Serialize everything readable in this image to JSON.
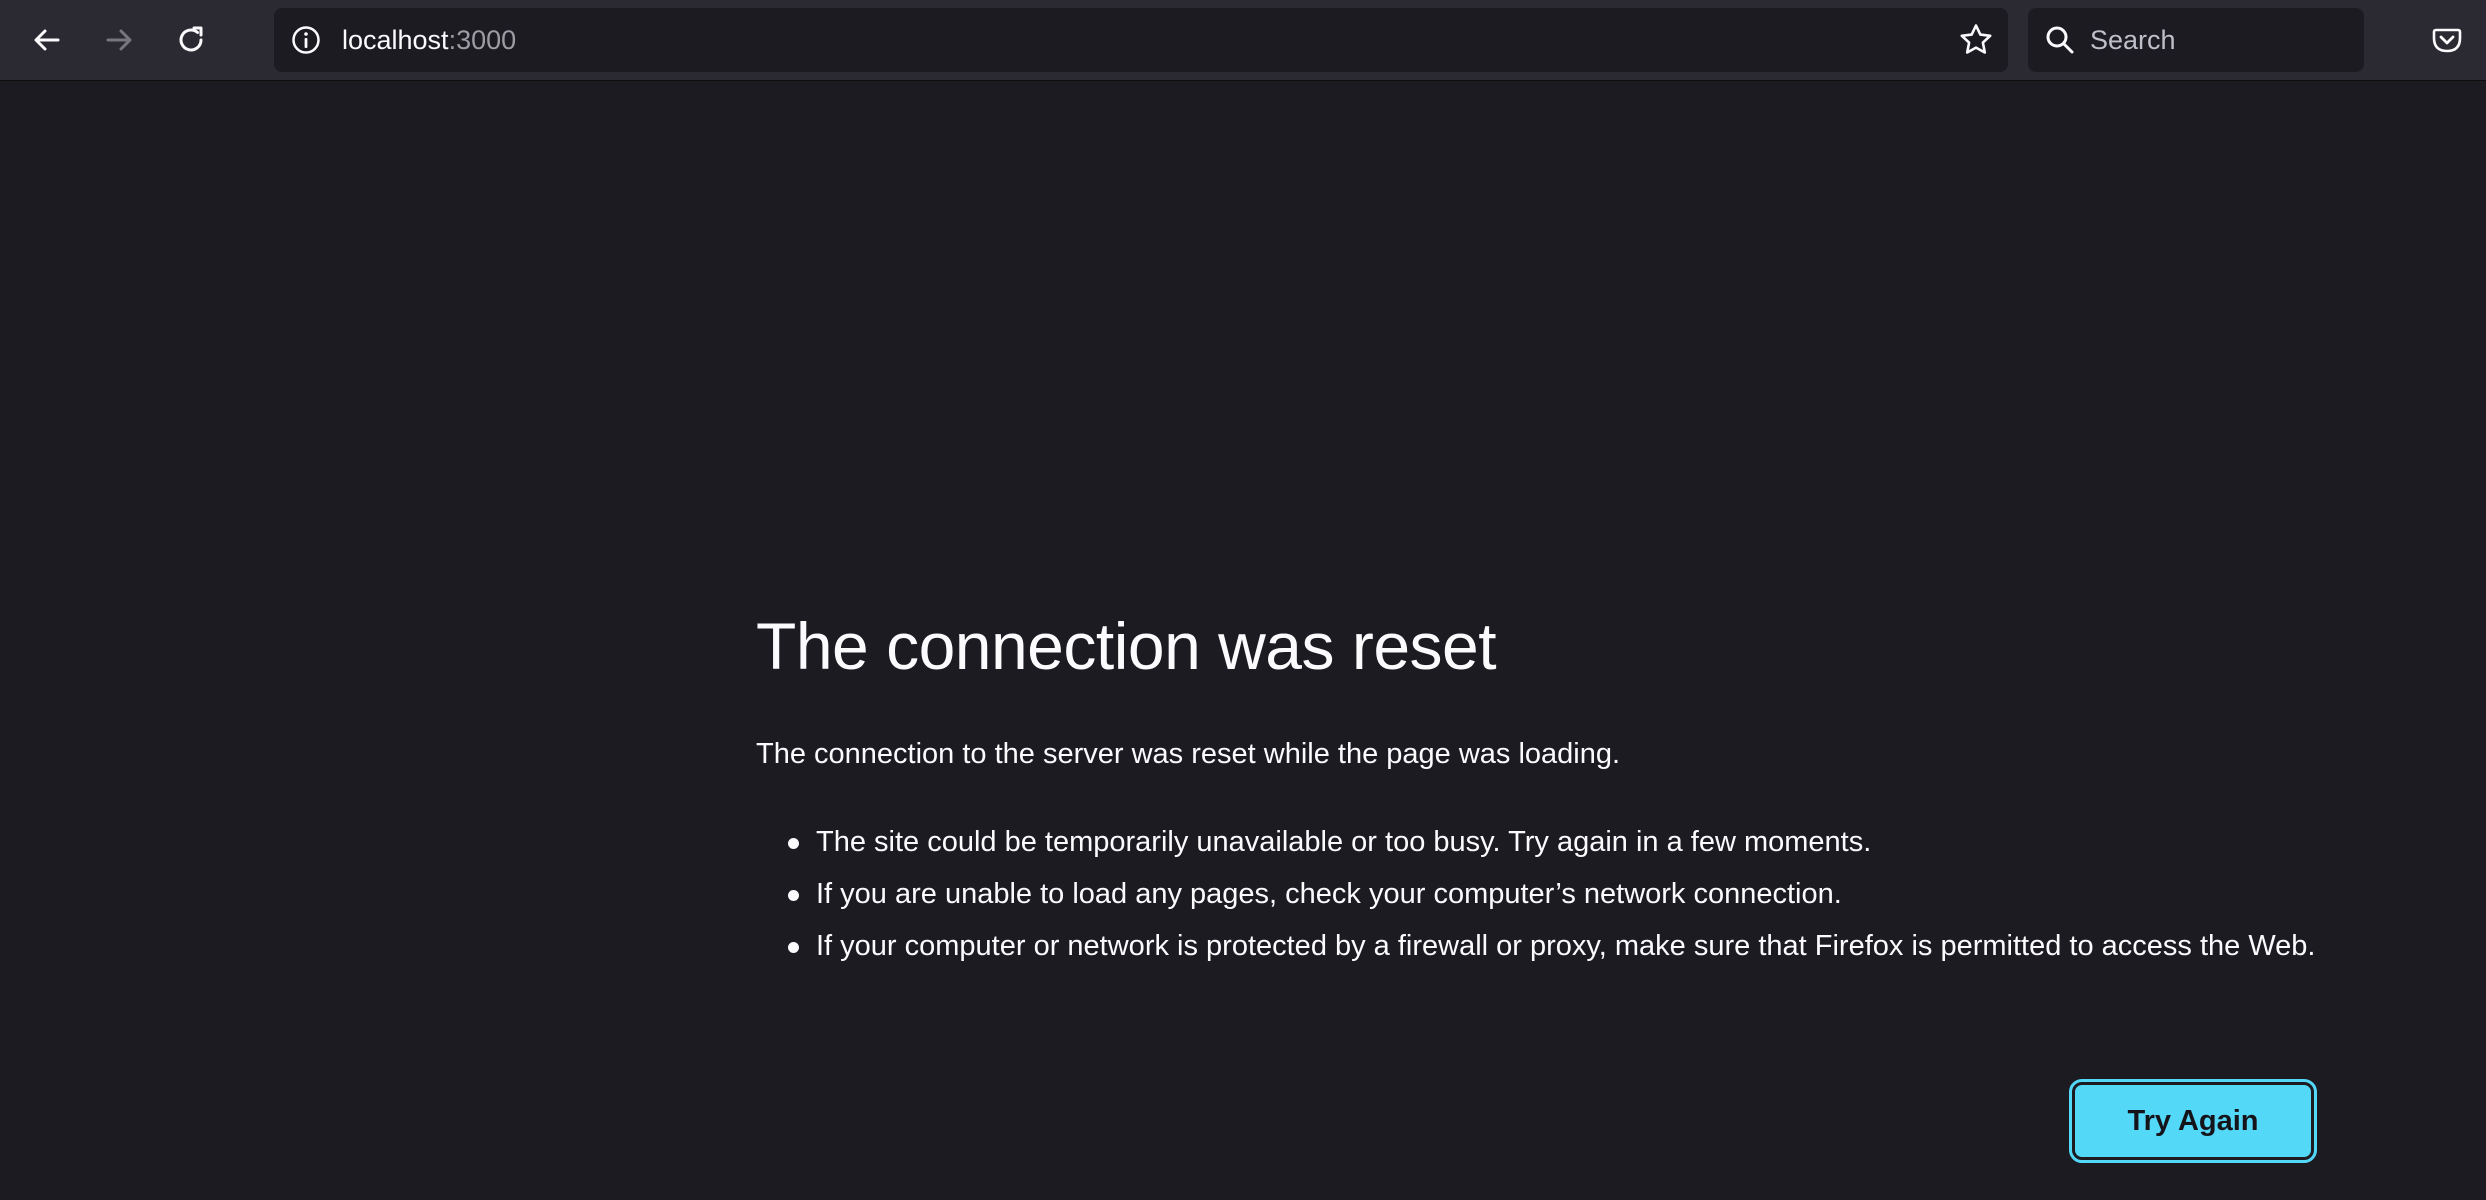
{
  "browser": {
    "nav": {
      "back_icon": "arrow-left-icon",
      "forward_icon": "arrow-right-icon",
      "reload_icon": "reload-icon"
    },
    "urlbar": {
      "host": "localhost",
      "port": ":3000",
      "info_icon": "info-icon",
      "bookmark_icon": "star-icon"
    },
    "search": {
      "placeholder": "Search",
      "icon": "search-icon"
    },
    "pocket_icon": "pocket-icon"
  },
  "error_page": {
    "title": "The connection was reset",
    "description": "The connection to the server was reset while the page was loading.",
    "reasons": [
      "The site could be temporarily unavailable or too busy. Try again in a few moments.",
      "If you are unable to load any pages, check your computer’s network connection.",
      "If your computer or network is protected by a firewall or proxy, make sure that Firefox is permitted to access the Web."
    ],
    "button_label": "Try Again"
  },
  "colors": {
    "page_background": "#1c1b22",
    "toolbar_background": "#2b2a33",
    "accent": "#54d8f7",
    "text": "#fbfbfe",
    "muted_text": "#9d9ca3"
  }
}
